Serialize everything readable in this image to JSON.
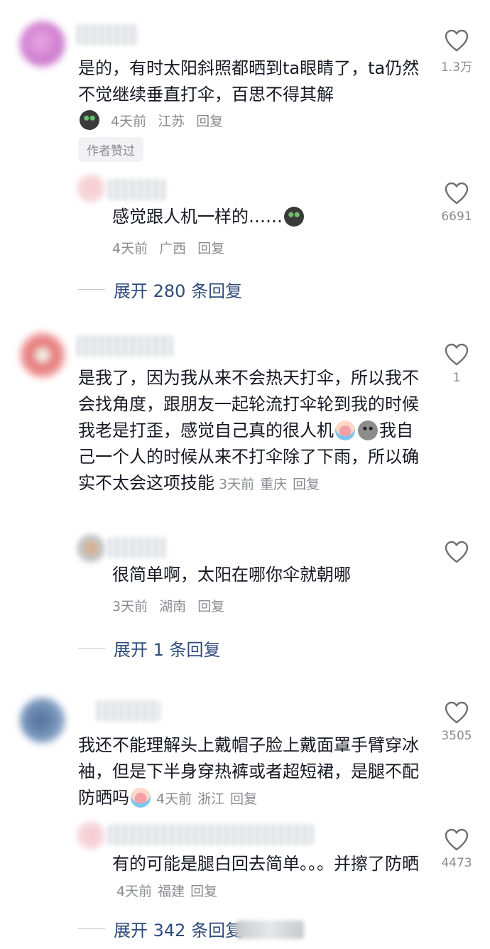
{
  "comments": [
    {
      "text": "是的，有时太阳斜照都晒到ta眼睛了，ta仍然不觉继续垂直打伞，百思不得其解",
      "emoji": "cat-emoji",
      "time": "4天前",
      "location": "江苏",
      "reply_label": "回复",
      "author_tag": "作者赞过",
      "likes": "1.3万",
      "sub_reply": {
        "text": "感觉跟人机一样的……",
        "emoji": "cat-emoji",
        "time": "4天前",
        "location": "广西",
        "reply_label": "回复",
        "likes": "6691"
      },
      "expand_label": "展开 280 条回复"
    },
    {
      "text_part1": "是我了，因为我从来不会热天打伞，所以我不会找角度，跟朋友一起轮流打伞轮到我的时候我老是打歪，感觉自己真的很人机",
      "text_part2": "我自己一个人的时候从来不打伞除了下雨，所以确实不太会这项技能",
      "time": "3天前",
      "location": "重庆",
      "reply_label": "回复",
      "likes": "1",
      "sub_reply": {
        "text": "很简单啊，太阳在哪你伞就朝哪",
        "time": "3天前",
        "location": "湖南",
        "reply_label": "回复",
        "likes": ""
      },
      "expand_label": "展开 1 条回复"
    },
    {
      "text": "我还不能理解头上戴帽子脸上戴面罩手臂穿冰袖，但是下半身穿热裤或者超短裙，是腿不配防晒吗",
      "time": "4天前",
      "location": "浙江",
      "reply_label": "回复",
      "likes": "3505",
      "sub_reply": {
        "text": "有的可能是腿白回去简单。。。并擦了防晒",
        "time": "4天前",
        "location": "福建",
        "reply_label": "回复",
        "likes": "4473"
      },
      "expand_label": "展开 342 条回复"
    }
  ],
  "colors": {
    "text": "#161823",
    "meta": "#8a8b91",
    "expand": "#2e4a7a",
    "heart_stroke": "#6f7076"
  }
}
